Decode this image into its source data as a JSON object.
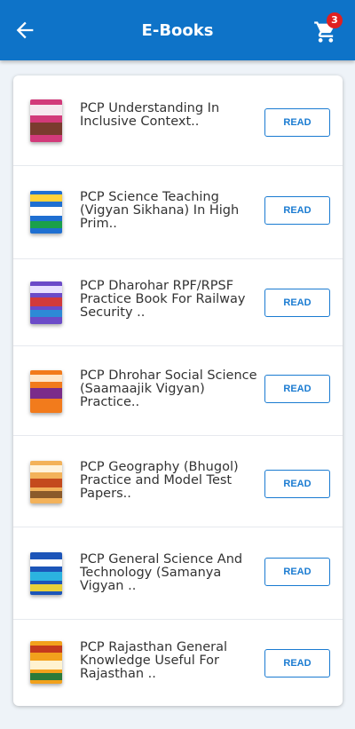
{
  "header": {
    "title": "E-Books",
    "cart_count": "3",
    "back_icon": "arrow-left-icon",
    "cart_icon": "shopping-cart-icon"
  },
  "colors": {
    "appbar": "#0e73c8",
    "accent": "#1a7bd1",
    "badge": "#e02020"
  },
  "books": [
    {
      "title": "PCP Understanding In Inclusive Context..",
      "button": "READ"
    },
    {
      "title": "PCP Science Teaching (Vigyan Sikhana) In High Prim..",
      "button": "READ"
    },
    {
      "title": "PCP Dharohar RPF/RPSF Practice Book For Railway Security ..",
      "button": "READ"
    },
    {
      "title": "PCP Dhrohar Social Science (Saamaajik Vigyan) Practice..",
      "button": "READ"
    },
    {
      "title": "PCP Geography (Bhugol) Practice and Model Test Papers..",
      "button": "READ"
    },
    {
      "title": "PCP General Science And Technology (Samanya Vigyan ..",
      "button": "READ"
    },
    {
      "title": "PCP Rajasthan General Knowledge Useful For Rajasthan ..",
      "button": "READ"
    }
  ]
}
